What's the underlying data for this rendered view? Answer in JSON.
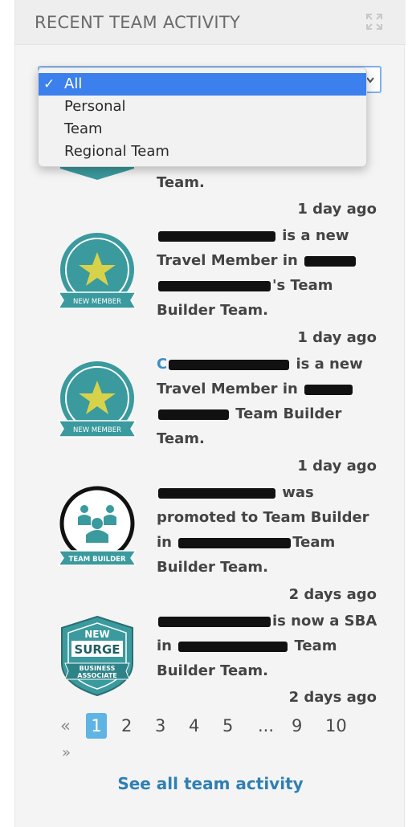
{
  "header": {
    "title": "RECENT TEAM ACTIVITY"
  },
  "filter": {
    "selected": "All",
    "options": [
      "All",
      "Personal",
      "Team",
      "Regional Team"
    ]
  },
  "feed": {
    "item0": {
      "text_tail": "Team.",
      "time": "1 day ago"
    },
    "item1": {
      "text_a": " is a new",
      "text_b": "Travel Member in ",
      "text_c": "'s Team",
      "text_d": "Builder Team.",
      "badge_label": "NEW MEMBER",
      "time": "1 day ago"
    },
    "item2": {
      "name_prefix": "C",
      "text_a": " is a new",
      "text_b": "Travel Member in ",
      "text_c": " Team Builder",
      "text_d": "Team.",
      "badge_label": "NEW MEMBER",
      "time": "1 day ago"
    },
    "item3": {
      "text_a": " was",
      "text_b": "promoted to Team Builder",
      "text_c": "in ",
      "text_c2": "Team",
      "text_d": "Builder Team.",
      "badge_label": "TEAM BUILDER",
      "time": "2 days ago"
    },
    "item4": {
      "text_a": "is now a SBA",
      "text_b": "in ",
      "text_b2": " Team",
      "text_c": "Builder Team.",
      "badge_top": "NEW",
      "badge_mid": "SURGE",
      "badge_bot1": "BUSINESS",
      "badge_bot2": "ASSOCIATE",
      "time": "2 days ago"
    }
  },
  "pagination": {
    "prev": "«",
    "next": "»",
    "pages": [
      "1",
      "2",
      "3",
      "4",
      "5",
      "...",
      "9",
      "10"
    ],
    "current": "1"
  },
  "footer": {
    "see_all": "See all team activity"
  },
  "colors": {
    "accent": "#3b80ec",
    "link": "#2f7fb4",
    "badge_teal": "#3a9a9e",
    "badge_star": "#d8d24a"
  }
}
